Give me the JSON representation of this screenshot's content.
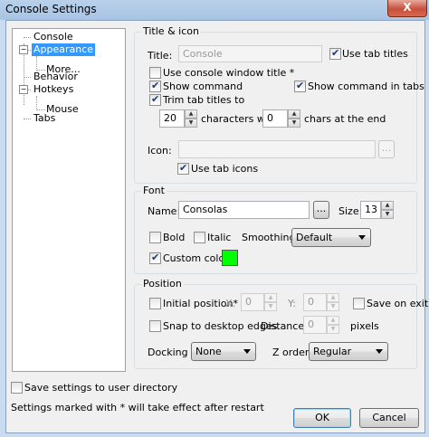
{
  "window": {
    "title": "Console Settings",
    "close_glyph": "X"
  },
  "tree": {
    "items": [
      {
        "label": "Console"
      },
      {
        "label": "Appearance",
        "expanded": true,
        "selected": true
      },
      {
        "label": "More..."
      },
      {
        "label": "Behavior"
      },
      {
        "label": "Hotkeys",
        "expanded": true
      },
      {
        "label": "Mouse"
      },
      {
        "label": "Tabs"
      }
    ],
    "collapse_glyph": "−"
  },
  "title_icon": {
    "group_label": "Title & icon",
    "title_label": "Title:",
    "title_value": "Console",
    "use_tab_titles": {
      "label": "Use tab titles",
      "checked": true
    },
    "use_console_window_title": {
      "label": "Use console window title *",
      "checked": false
    },
    "show_command": {
      "label": "Show command",
      "checked": true
    },
    "show_command_in_tabs": {
      "label": "Show command in tabs",
      "checked": true
    },
    "trim_tab_titles": {
      "label": "Trim tab titles to",
      "checked": true
    },
    "trim_chars": "20",
    "characters_with_label": "characters with",
    "chars_at_end": "0",
    "chars_at_end_label": "chars at the end",
    "icon_label": "Icon:",
    "icon_value": "",
    "browse_label": "...",
    "use_tab_icons": {
      "label": "Use tab icons",
      "checked": true
    }
  },
  "font": {
    "group_label": "Font",
    "name_label": "Name:",
    "name_value": "Consolas",
    "browse_label": "...",
    "size_label": "Size:",
    "size_value": "13",
    "bold": {
      "label": "Bold",
      "checked": false
    },
    "italic": {
      "label": "Italic",
      "checked": false
    },
    "smoothing_label": "Smoothing:",
    "smoothing_value": "Default",
    "custom_color": {
      "label": "Custom color:",
      "checked": true
    },
    "custom_color_value": "#00ff00"
  },
  "position": {
    "group_label": "Position",
    "initial_position": {
      "label": "Initial position*",
      "checked": false
    },
    "x_label": "X:",
    "x_value": "0",
    "y_label": "Y:",
    "y_value": "0",
    "save_on_exit": {
      "label": "Save on exit",
      "checked": false
    },
    "snap_to_desktop": {
      "label": "Snap to desktop edges",
      "checked": false
    },
    "distance_label": "Distance:",
    "distance_value": "0",
    "pixels_label": "pixels",
    "docking_label": "Docking *:",
    "docking_value": "None",
    "z_order_label": "Z order:",
    "z_order_value": "Regular"
  },
  "footer": {
    "save_to_user_dir": {
      "label": "Save settings to user directory",
      "checked": false
    },
    "restart_note": "Settings marked with * will take effect after restart",
    "ok_label": "OK",
    "cancel_label": "Cancel"
  },
  "icons": {
    "up_arrow": "▲",
    "down_arrow": "▼"
  }
}
